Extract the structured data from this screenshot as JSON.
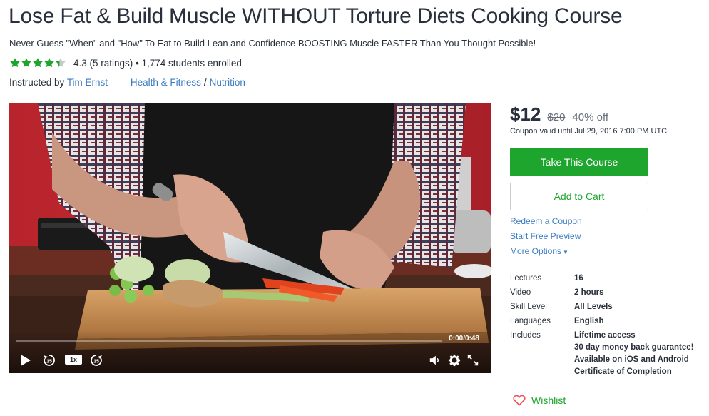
{
  "course": {
    "title": "Lose Fat & Build Muscle WITHOUT Torture Diets Cooking Course",
    "subtitle": "Never Guess \"When\" and \"How\" To Eat to Build Lean and Confidence BOOSTING Muscle FASTER Than You Thought Possible!",
    "rating_value": 4.3,
    "rating_text": "4.3 (5 ratings) • 1,774 students enrolled",
    "instructed_by_label": "Instructed by",
    "instructor_name": "Tim Ernst",
    "category": "Health & Fitness",
    "category_sep": "/",
    "subcategory": "Nutrition"
  },
  "video": {
    "time": "0:00/0:48",
    "progress": 0,
    "speed": "1x",
    "icons": [
      "play-icon",
      "rewind-15-icon",
      "forward-15-icon",
      "volume-icon",
      "settings-icon",
      "fullscreen-icon"
    ]
  },
  "purchase": {
    "price": "$12",
    "original_price": "$20",
    "discount": "40% off",
    "coupon_note": "Coupon valid until Jul 29, 2016 7:00 PM UTC",
    "take_label": "Take This Course",
    "cart_label": "Add to Cart",
    "redeem_label": "Redeem a Coupon",
    "preview_label": "Start Free Preview",
    "more_label": "More Options",
    "wishlist_label": "Wishlist"
  },
  "details": {
    "lectures_label": "Lectures",
    "lectures": "16",
    "video_label": "Video",
    "video": "2 hours",
    "skill_label": "Skill Level",
    "skill": "All Levels",
    "languages_label": "Languages",
    "languages": "English",
    "includes_label": "Includes",
    "includes": [
      "Lifetime access",
      "30 day money back guarantee!",
      "Available on iOS and Android",
      "Certificate of Completion"
    ]
  },
  "colors": {
    "accent_green": "#1ea52e",
    "link_blue": "#3a7bc2",
    "text": "#29303b",
    "star": "#f4c150",
    "star_green": "#1ea52e"
  }
}
